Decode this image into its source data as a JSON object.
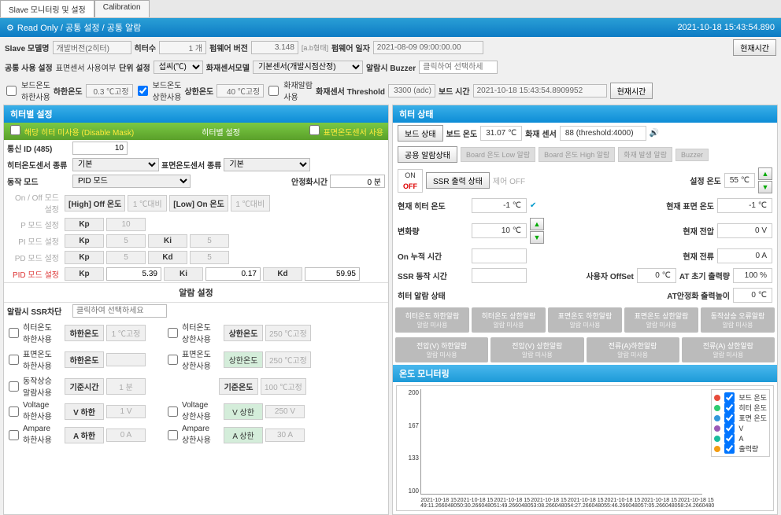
{
  "tabs": {
    "slave": "Slave 모니터링 및 설정",
    "calibration": "Calibration"
  },
  "header": {
    "readonly": "Read Only / 공통 설정 / 공통 알람",
    "timestamp": "2021-10-18 15:43:54.890"
  },
  "common": {
    "slave_model_label": "Slave 모델명",
    "slave_model_value": "개발버전(2히터)",
    "heater_count_label": "히터수",
    "heater_count_value": "1 개",
    "firmware_ver_label": "펌웨어 버전",
    "firmware_ver_value": "3.148",
    "firmware_ver_note": "[a.b형태]",
    "firmware_date_label": "펌웨어 일자",
    "firmware_date_value": "2021-08-09 09:00:00.00",
    "current_time_btn": "현재시간",
    "common_use_label": "공통 사용 설정",
    "surface_sensor_use": "표면센서 사용여부",
    "unit_label": "단위 설정",
    "unit_value": "섭씨(℃)",
    "fire_sensor_model_label": "화재센서모델",
    "fire_sensor_model_value": "기본센서(개발시점산정)",
    "alarm_buzzer_label": "알람시 Buzzer",
    "alarm_buzzer_placeholder": "클릭하여 선택하세",
    "board_low_use_label": "보드온도\n하한사용",
    "low_temp_label": "하한온도",
    "low_temp_value": "0.3 ℃고정",
    "board_high_use_label": "보드온도\n상한사용",
    "high_temp_label": "상한온도",
    "high_temp_value": "40 ℃고정",
    "fire_alarm_use_label": "화재알람\n사용",
    "fire_threshold_label": "화재센서 Threshold",
    "fire_threshold_value": "3300 (adc)",
    "board_time_label": "보드 시간",
    "board_time_value": "2021-10-18 15:43:54.8909952",
    "current_time_btn2": "현재시간"
  },
  "heater_settings": {
    "title": "히터별 설정",
    "disable_mask_label": "해당 히터 미사용 (Disable Mask)",
    "sub_title": "히터별 설정",
    "surface_sensor_use_label": "표면온도센서 사용",
    "comm_id_label": "통신 ID (485)",
    "comm_id_value": "10",
    "heater_sensor_type_label": "히터온도센서 종류",
    "heater_sensor_type_value": "기본",
    "surface_sensor_type_label": "표면온도센서 종류",
    "surface_sensor_type_value": "기본",
    "op_mode_label": "동작 모드",
    "op_mode_value": "PID 모드",
    "stabilize_time_label": "안정화시간",
    "stabilize_time_value": "0 분",
    "onoff_mode_label": "On / Off 모드 설정",
    "high_off_label": "[High] Off 온도",
    "high_off_unit": "1 ℃대비",
    "low_on_label": "[Low] On 온도",
    "low_on_unit": "1 ℃대비",
    "p_mode_label": "P 모드 설정",
    "pi_mode_label": "PI 모드 설정",
    "pd_mode_label": "PD 모드 설정",
    "pid_mode_label": "PID 모드 설정",
    "kp": "Kp",
    "ki": "Ki",
    "kd": "Kd",
    "p_kp": "10",
    "pi_kp": "5",
    "pi_ki": "5",
    "pd_kp": "5",
    "pd_kd": "5",
    "pid_kp": "5.39",
    "pid_ki": "0.17",
    "pid_kd": "59.95",
    "alarm_settings_title": "알람 설정",
    "alarm_ssr_label": "알람시 SSR차단",
    "alarm_ssr_placeholder": "클릭하여 선택하세요",
    "heater_low_use": "히터온도\n하한사용",
    "heater_low_label": "하한온도",
    "heater_low_value": "1 ℃고정",
    "heater_high_use": "히터온도\n상한사용",
    "heater_high_label": "상한온도",
    "heater_high_value": "250 ℃고정",
    "surface_low_use": "표면온도\n하한사용",
    "surface_low_label": "하한온도",
    "surface_high_use": "표면온도\n상한사용",
    "surface_high_label": "상한온도",
    "surface_high_value": "250 ℃고정",
    "malfunc_use": "동작상승\n알람사용",
    "ref_time_label": "기준시간",
    "ref_time_value": "1 분",
    "ref_temp_label": "기준온도",
    "ref_temp_value": "100 ℃고정",
    "voltage_low_use": "Voltage\n하한사용",
    "v_low_label": "V 하한",
    "v_low_value": "1 V",
    "voltage_high_use": "Voltage\n상한사용",
    "v_high_label": "V 상한",
    "v_high_value": "250 V",
    "ampere_low_use": "Ampare\n하한사용",
    "a_low_label": "A 하한",
    "a_low_value": "0 A",
    "ampere_high_use": "Ampare\n상한사용",
    "a_high_label": "A 상한",
    "a_high_value": "30 A"
  },
  "heater_status": {
    "title": "히터 상태",
    "board_status_label": "보드 상태",
    "board_temp_label": "보드 온도",
    "board_temp_value": "31.07 ℃",
    "fire_sensor_label": "화재 센서",
    "fire_sensor_value": "88 (threshold:4000)",
    "common_alarm_label": "공용 알람상태",
    "board_low_alarm": "Board 온도 Low 알람",
    "board_high_alarm": "Board 온도 High 알람",
    "fire_alarm": "화재 발생 알람",
    "buzzer_btn": "Buzzer",
    "on": "ON",
    "off": "OFF",
    "ssr_output_label": "SSR 출력 상태",
    "control_off": "제어 OFF",
    "set_temp_label": "설정 온도",
    "set_temp_value": "55 ℃",
    "current_heater_temp_label": "현재 히터 온도",
    "current_heater_temp_value": "-1 ℃",
    "current_surface_temp_label": "현재 표면 온도",
    "current_surface_temp_value": "-1 ℃",
    "delta_label": "변화량",
    "delta_value": "10 ℃",
    "current_voltage_label": "현재 전압",
    "current_voltage_value": "0 V",
    "on_cumul_label": "On 누적 시간",
    "current_current_label": "현재 전류",
    "current_current_value": "0 A",
    "ssr_op_time_label": "SSR 동작 시간",
    "user_offset_label": "사용자 OffSet",
    "user_offset_value": "0 ℃",
    "at_init_output_label": "AT 초기 출력량",
    "at_init_output_value": "100 %",
    "heater_alarm_status_label": "히터 알람 상태",
    "at_stable_output_label": "AT안정화 출력높이",
    "at_stable_output_value": "0 ℃",
    "tiles": {
      "heater_low": "히터온도 하한알람",
      "heater_high": "히터온도 상한알람",
      "surface_low": "표면온도 하한알람",
      "surface_high": "표면온도 상한알람",
      "malfunc": "동작상승 오류알람",
      "v_low": "전압(V) 하한알람",
      "v_high": "전압(V) 상한알람",
      "a_low": "전류(A)하한알람",
      "a_high": "전류(A) 상한알람",
      "sub": "알람 미사용"
    },
    "chart_title": "온도 모니터링",
    "legend": {
      "board": "보드 온도",
      "heater": "히터 온도",
      "surface": "표면 온도",
      "v": "V",
      "a": "A",
      "output": "출력량"
    },
    "chart_data": {
      "type": "line",
      "ylim": [
        100,
        200
      ],
      "yticks": [
        200,
        167,
        133,
        100
      ],
      "xticks": [
        "2021-10-18 15\n49:11.2660480",
        "2021-10-18 15\n50:30.2660480",
        "2021-10-18 15\n51:49.2660480",
        "2021-10-18 15\n53:08.2660480",
        "2021-10-18 15\n54:27.2660480",
        "2021-10-18 15\n55:46.2660480",
        "2021-10-18 15\n57:05.2660480",
        "2021-10-18 15\n58:24.2660480"
      ],
      "series": [
        {
          "name": "보드 온도",
          "color": "#e74c3c"
        },
        {
          "name": "히터 온도",
          "color": "#2ecc71"
        },
        {
          "name": "표면 온도",
          "color": "#3498db"
        },
        {
          "name": "V",
          "color": "#9b59b6"
        },
        {
          "name": "A",
          "color": "#1abc9c"
        },
        {
          "name": "출력량",
          "color": "#f39c12"
        }
      ]
    }
  }
}
